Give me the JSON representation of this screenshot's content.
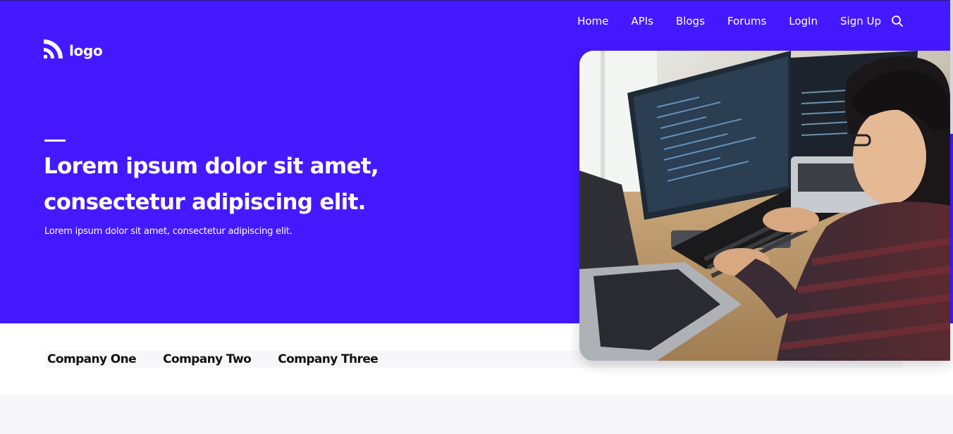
{
  "nav": {
    "items": [
      "Home",
      "APIs",
      "Blogs",
      "Forums",
      "LogIn",
      "Sign Up"
    ],
    "search_icon": "search-icon"
  },
  "logo": {
    "text": "logo",
    "icon": "rss-feed-icon"
  },
  "hero": {
    "title_line1": "Lorem ipsum dolor sit amet,",
    "title_line2": "consectetur adipiscing elit.",
    "subtitle": "Lorem ipsum dolor sit amet, consectetur adipiscing elit.",
    "image_subject": "developer-at-computer-photo"
  },
  "companies": [
    "Company One",
    "Company Two",
    "Company Three"
  ],
  "colors": {
    "brand": "#4419ff",
    "text_on_brand": "#ffffff",
    "page_bg": "#f7f7f9"
  }
}
